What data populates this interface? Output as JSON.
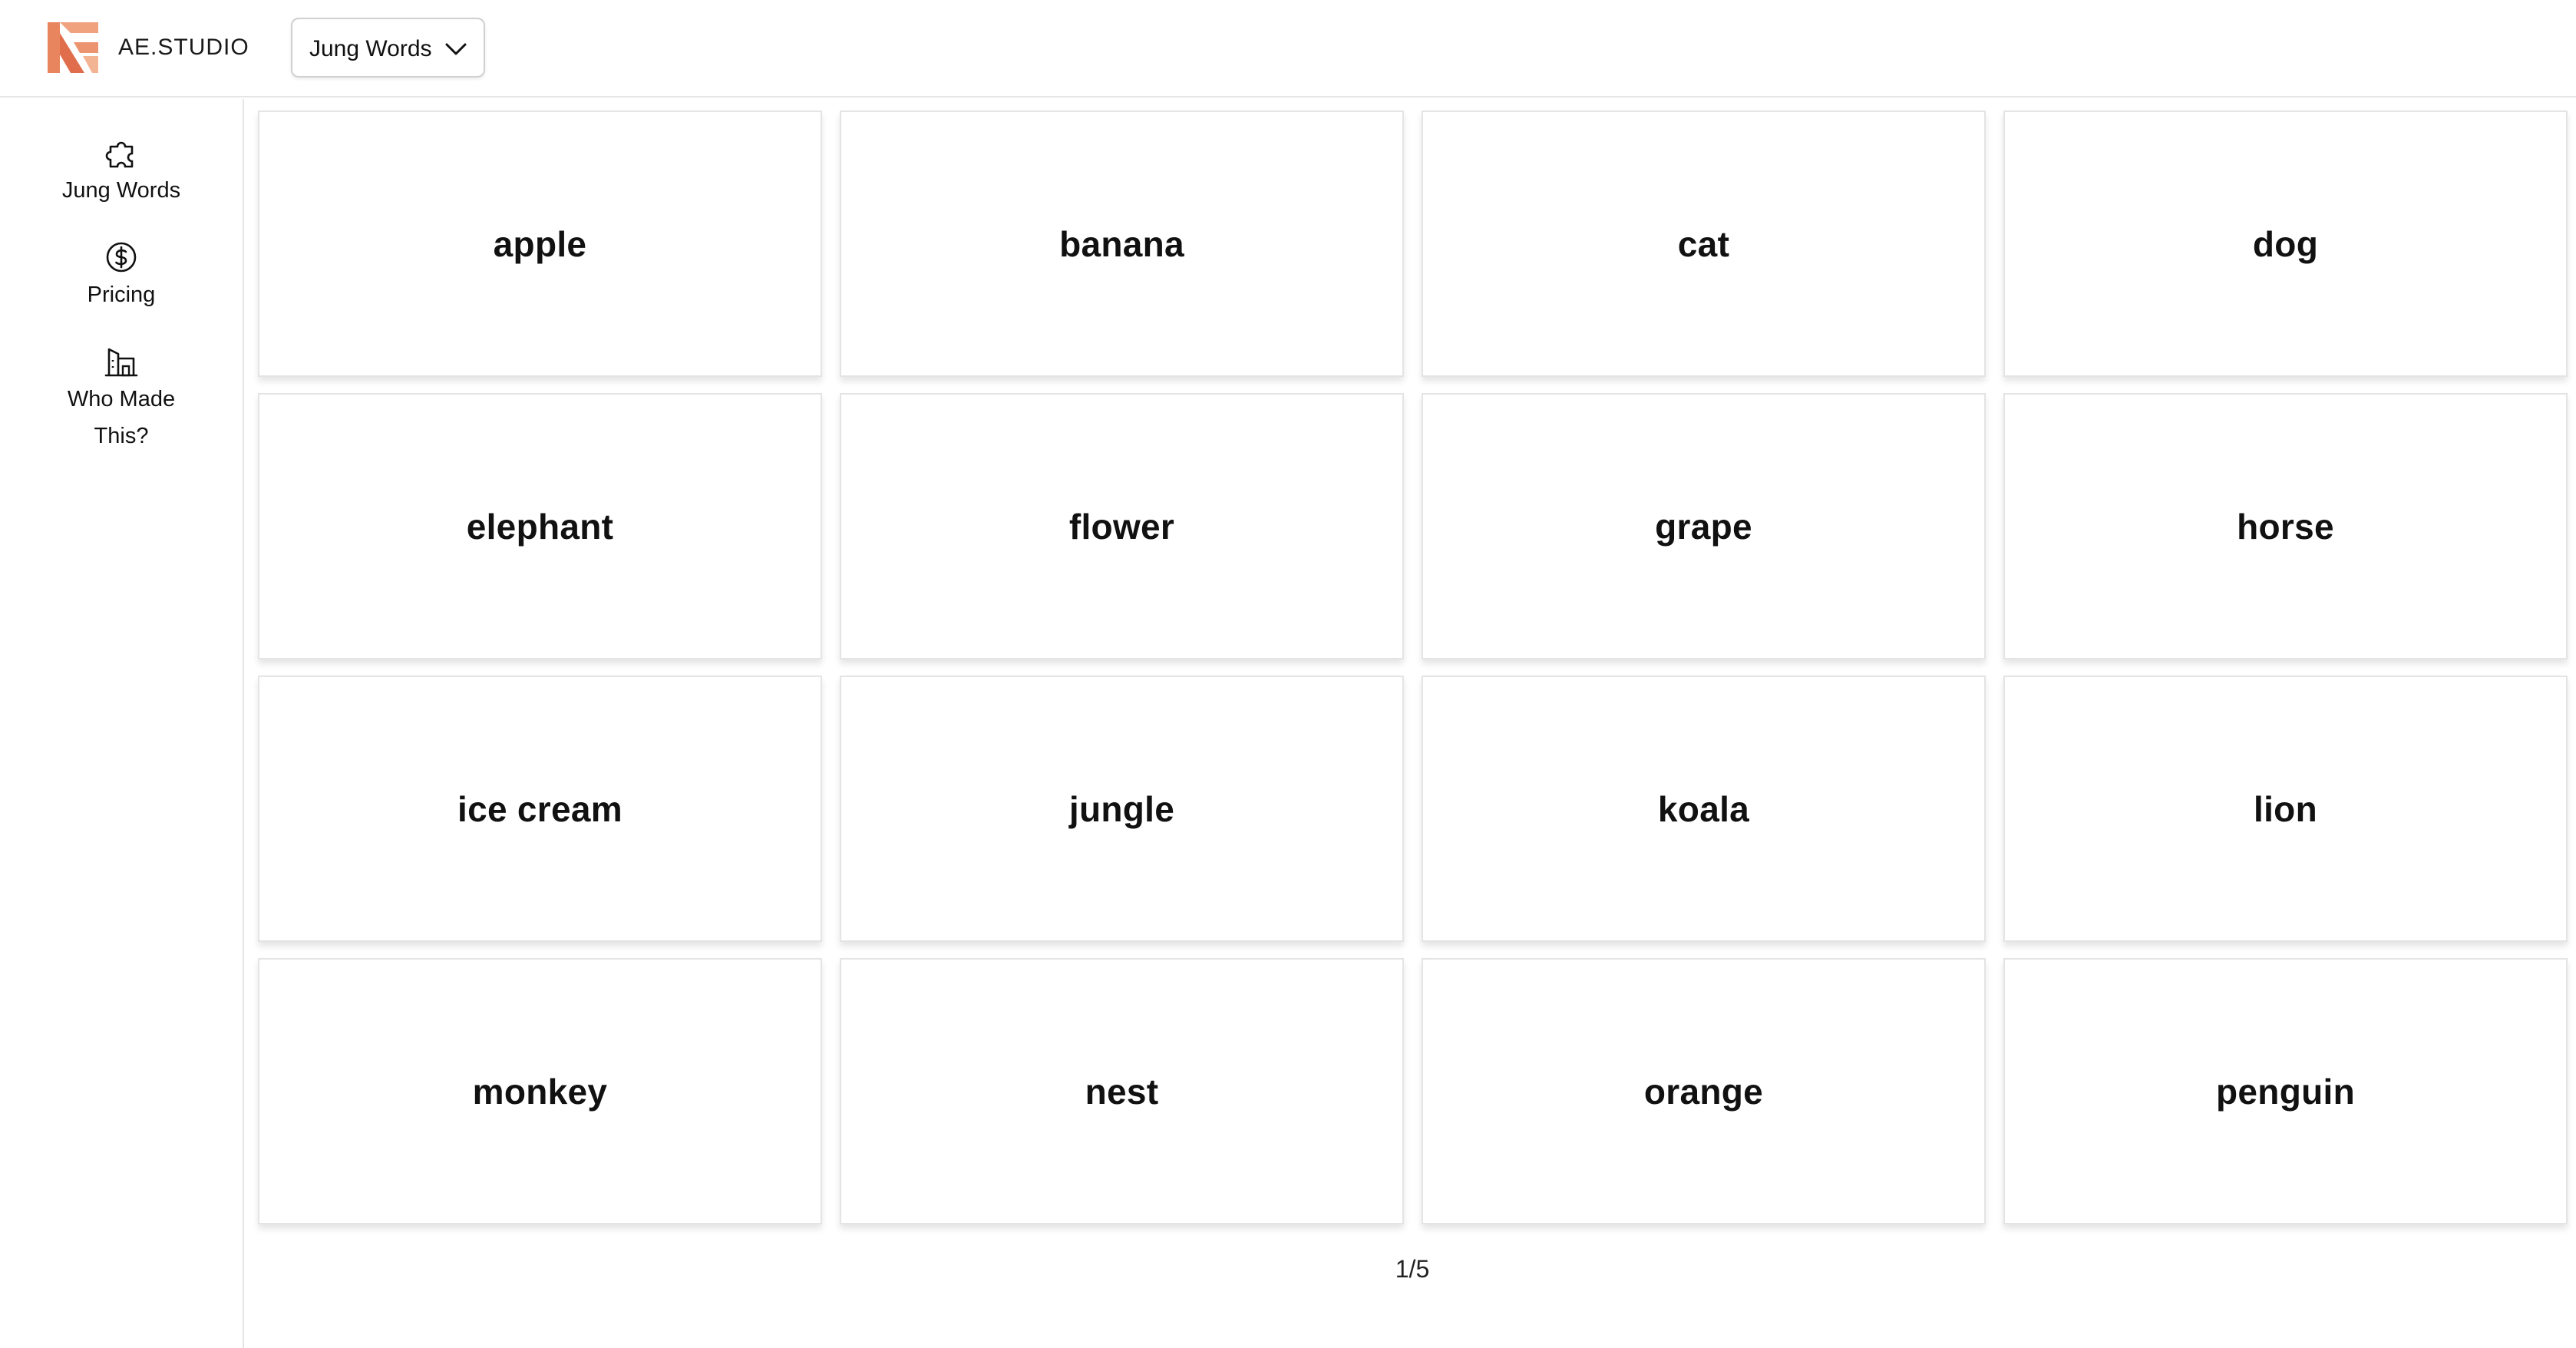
{
  "header": {
    "brand": "AE.STUDIO",
    "dropdown_label": "Jung Words",
    "logo_color": "#E8855F"
  },
  "sidebar": {
    "items": [
      {
        "label": "Jung Words",
        "icon": "puzzle-piece-icon"
      },
      {
        "label": "Pricing",
        "icon": "dollar-circle-icon"
      },
      {
        "label": "Who Made This?",
        "icon": "building-icon"
      }
    ]
  },
  "cards": [
    "apple",
    "banana",
    "cat",
    "dog",
    "elephant",
    "flower",
    "grape",
    "horse",
    "ice cream",
    "jungle",
    "koala",
    "lion",
    "monkey",
    "nest",
    "orange",
    "penguin"
  ],
  "pagination": "1/5"
}
